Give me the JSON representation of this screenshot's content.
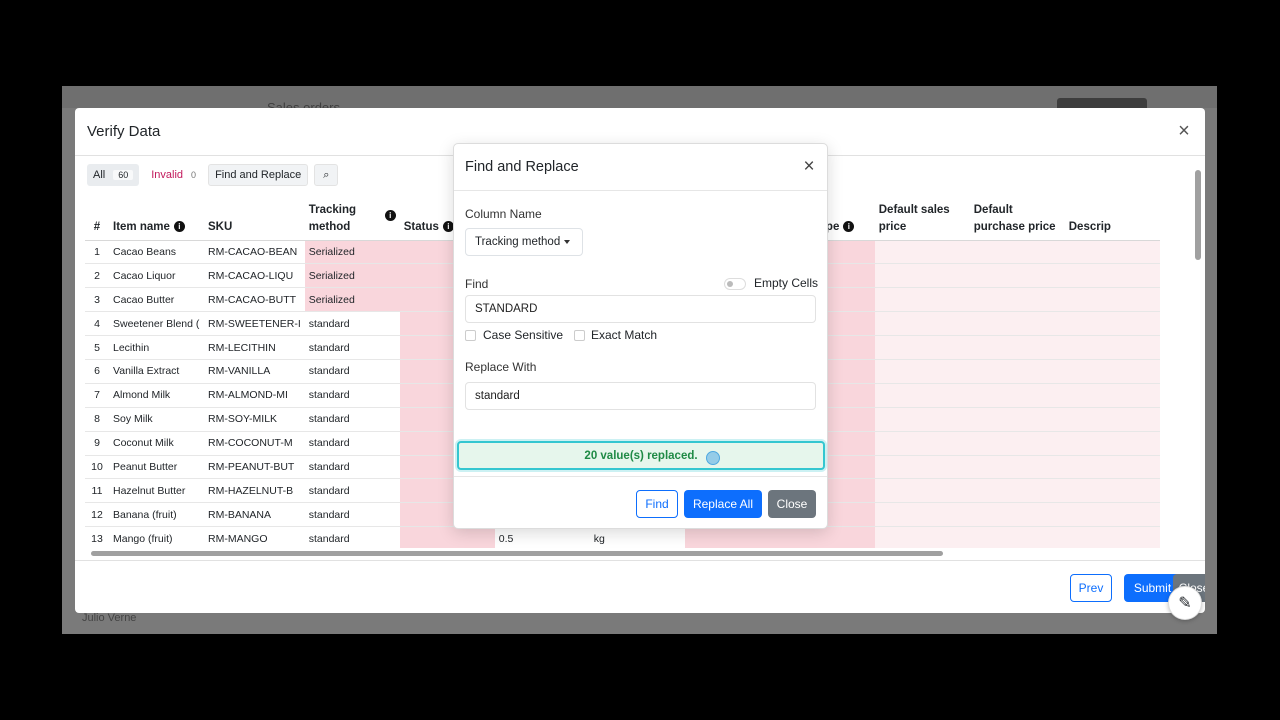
{
  "background": {
    "title": "Sales orders",
    "footer_user": "Julio Verne"
  },
  "verify": {
    "title": "Verify Data",
    "close_glyph": "×",
    "toolbar": {
      "all_label": "All",
      "all_count": "60",
      "invalid_label": "Invalid",
      "invalid_count": "0",
      "find_replace_label": "Find and Replace",
      "search_glyph": "⌕"
    },
    "table": {
      "headers": {
        "num": "#",
        "item_name": "Item name",
        "sku": "SKU",
        "tracking": "Tracking method",
        "status": "Status",
        "make_type": "Make type",
        "sales_price": "Default sales price",
        "purchase_price": "Default purchase price",
        "description": "Descrip"
      },
      "rows": [
        {
          "n": "1",
          "name": "Cacao Beans",
          "sku": "RM-CACAO-BEAN",
          "track": "Serialized",
          "qty": "",
          "unit": ""
        },
        {
          "n": "2",
          "name": "Cacao Liquor",
          "sku": "RM-CACAO-LIQU",
          "track": "Serialized",
          "qty": "",
          "unit": ""
        },
        {
          "n": "3",
          "name": "Cacao Butter",
          "sku": "RM-CACAO-BUTT",
          "track": "Serialized",
          "qty": "",
          "unit": ""
        },
        {
          "n": "4",
          "name": "Sweetener Blend (",
          "sku": "RM-SWEETENER-I",
          "track": "standard",
          "qty": "",
          "unit": ""
        },
        {
          "n": "5",
          "name": "Lecithin",
          "sku": "RM-LECITHIN",
          "track": "standard",
          "qty": "",
          "unit": ""
        },
        {
          "n": "6",
          "name": "Vanilla Extract",
          "sku": "RM-VANILLA",
          "track": "standard",
          "qty": "",
          "unit": ""
        },
        {
          "n": "7",
          "name": "Almond Milk",
          "sku": "RM-ALMOND-MI",
          "track": "standard",
          "qty": "",
          "unit": ""
        },
        {
          "n": "8",
          "name": "Soy Milk",
          "sku": "RM-SOY-MILK",
          "track": "standard",
          "qty": "",
          "unit": ""
        },
        {
          "n": "9",
          "name": "Coconut Milk",
          "sku": "RM-COCONUT-M",
          "track": "standard",
          "qty": "",
          "unit": ""
        },
        {
          "n": "10",
          "name": "Peanut Butter",
          "sku": "RM-PEANUT-BUT",
          "track": "standard",
          "qty": "",
          "unit": ""
        },
        {
          "n": "11",
          "name": "Hazelnut Butter",
          "sku": "RM-HAZELNUT-B",
          "track": "standard",
          "qty": "",
          "unit": ""
        },
        {
          "n": "12",
          "name": "Banana (fruit)",
          "sku": "RM-BANANA",
          "track": "standard",
          "qty": "",
          "unit": ""
        },
        {
          "n": "13",
          "name": "Mango (fruit)",
          "sku": "RM-MANGO",
          "track": "standard",
          "qty": "0.5",
          "unit": "kg"
        }
      ]
    },
    "footer": {
      "prev": "Prev",
      "submit": "Submit",
      "close": "Close"
    }
  },
  "find_replace": {
    "title": "Find and Replace",
    "close_glyph": "×",
    "column_name_label": "Column Name",
    "column_selected": "Tracking method",
    "find_label": "Find",
    "empty_cells_label": "Empty Cells",
    "find_value": "STANDARD",
    "case_sensitive_label": "Case Sensitive",
    "exact_match_label": "Exact Match",
    "replace_label": "Replace With",
    "replace_value": "standard",
    "alert": "20 value(s) replaced.",
    "btn_find": "Find",
    "btn_replace_all": "Replace All",
    "btn_close": "Close"
  },
  "fab_glyph": "✎"
}
